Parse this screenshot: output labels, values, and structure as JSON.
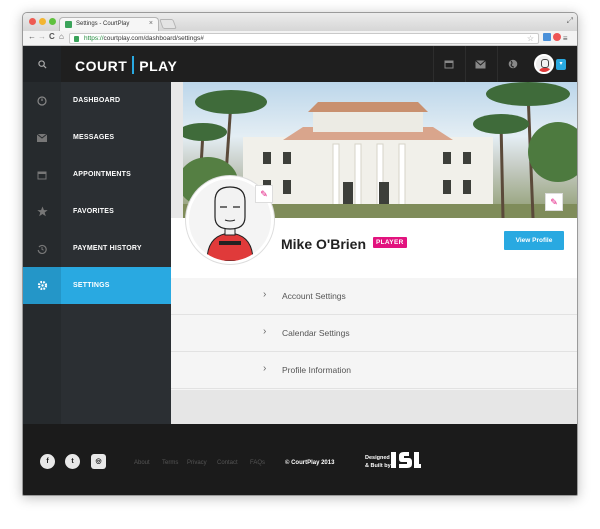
{
  "browser": {
    "tab_title": "Settings - CourtPlay",
    "tab_close": "×",
    "url_scheme": "https://",
    "url_rest": "courtplay.com/dashboard/settings#",
    "back": "←",
    "forward": "→",
    "reload": "C",
    "home": "⌂",
    "star": "☆",
    "menu": "≡",
    "resize": "⤢"
  },
  "header": {
    "logo_left": "COURT",
    "logo_right": "PLAY"
  },
  "sidebar": {
    "items": [
      {
        "label": "DASHBOARD",
        "icon": "dashboard-icon"
      },
      {
        "label": "MESSAGES",
        "icon": "envelope-icon"
      },
      {
        "label": "APPOINTMENTS",
        "icon": "calendar-icon"
      },
      {
        "label": "FAVORITES",
        "icon": "star-icon"
      },
      {
        "label": "PAYMENT HISTORY",
        "icon": "history-icon"
      },
      {
        "label": "SETTINGS",
        "icon": "gear-icon"
      }
    ],
    "active_index": 5
  },
  "profile": {
    "name": "Mike O'Brien",
    "badge": "PLAYER",
    "view_button": "View Profile",
    "edit_glyph": "✎"
  },
  "settings_list": [
    {
      "label": "Account Settings"
    },
    {
      "label": "Calendar Settings"
    },
    {
      "label": "Profile Information"
    }
  ],
  "chevron": "›",
  "footer": {
    "social": [
      "f",
      "t",
      "◎"
    ],
    "links": [
      "About",
      "Terms",
      "Privacy",
      "Contact",
      "FAQs"
    ],
    "copyright": "© CourtPlay 2013",
    "designed_line1": "Designed",
    "designed_line2": "& Built by"
  },
  "colors": {
    "accent": "#29a9e1",
    "badge": "#e2137e",
    "sidebar": "#2b2f33",
    "footer": "#1b1b1b"
  }
}
